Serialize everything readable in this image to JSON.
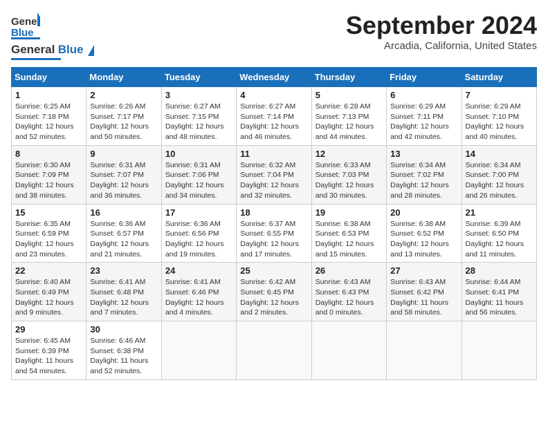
{
  "header": {
    "logo_general": "General",
    "logo_blue": "Blue",
    "month": "September 2024",
    "location": "Arcadia, California, United States"
  },
  "weekdays": [
    "Sunday",
    "Monday",
    "Tuesday",
    "Wednesday",
    "Thursday",
    "Friday",
    "Saturday"
  ],
  "weeks": [
    [
      {
        "day": "1",
        "sunrise": "Sunrise: 6:25 AM",
        "sunset": "Sunset: 7:18 PM",
        "daylight": "Daylight: 12 hours and 52 minutes."
      },
      {
        "day": "2",
        "sunrise": "Sunrise: 6:26 AM",
        "sunset": "Sunset: 7:17 PM",
        "daylight": "Daylight: 12 hours and 50 minutes."
      },
      {
        "day": "3",
        "sunrise": "Sunrise: 6:27 AM",
        "sunset": "Sunset: 7:15 PM",
        "daylight": "Daylight: 12 hours and 48 minutes."
      },
      {
        "day": "4",
        "sunrise": "Sunrise: 6:27 AM",
        "sunset": "Sunset: 7:14 PM",
        "daylight": "Daylight: 12 hours and 46 minutes."
      },
      {
        "day": "5",
        "sunrise": "Sunrise: 6:28 AM",
        "sunset": "Sunset: 7:13 PM",
        "daylight": "Daylight: 12 hours and 44 minutes."
      },
      {
        "day": "6",
        "sunrise": "Sunrise: 6:29 AM",
        "sunset": "Sunset: 7:11 PM",
        "daylight": "Daylight: 12 hours and 42 minutes."
      },
      {
        "day": "7",
        "sunrise": "Sunrise: 6:29 AM",
        "sunset": "Sunset: 7:10 PM",
        "daylight": "Daylight: 12 hours and 40 minutes."
      }
    ],
    [
      {
        "day": "8",
        "sunrise": "Sunrise: 6:30 AM",
        "sunset": "Sunset: 7:09 PM",
        "daylight": "Daylight: 12 hours and 38 minutes."
      },
      {
        "day": "9",
        "sunrise": "Sunrise: 6:31 AM",
        "sunset": "Sunset: 7:07 PM",
        "daylight": "Daylight: 12 hours and 36 minutes."
      },
      {
        "day": "10",
        "sunrise": "Sunrise: 6:31 AM",
        "sunset": "Sunset: 7:06 PM",
        "daylight": "Daylight: 12 hours and 34 minutes."
      },
      {
        "day": "11",
        "sunrise": "Sunrise: 6:32 AM",
        "sunset": "Sunset: 7:04 PM",
        "daylight": "Daylight: 12 hours and 32 minutes."
      },
      {
        "day": "12",
        "sunrise": "Sunrise: 6:33 AM",
        "sunset": "Sunset: 7:03 PM",
        "daylight": "Daylight: 12 hours and 30 minutes."
      },
      {
        "day": "13",
        "sunrise": "Sunrise: 6:34 AM",
        "sunset": "Sunset: 7:02 PM",
        "daylight": "Daylight: 12 hours and 28 minutes."
      },
      {
        "day": "14",
        "sunrise": "Sunrise: 6:34 AM",
        "sunset": "Sunset: 7:00 PM",
        "daylight": "Daylight: 12 hours and 26 minutes."
      }
    ],
    [
      {
        "day": "15",
        "sunrise": "Sunrise: 6:35 AM",
        "sunset": "Sunset: 6:59 PM",
        "daylight": "Daylight: 12 hours and 23 minutes."
      },
      {
        "day": "16",
        "sunrise": "Sunrise: 6:36 AM",
        "sunset": "Sunset: 6:57 PM",
        "daylight": "Daylight: 12 hours and 21 minutes."
      },
      {
        "day": "17",
        "sunrise": "Sunrise: 6:36 AM",
        "sunset": "Sunset: 6:56 PM",
        "daylight": "Daylight: 12 hours and 19 minutes."
      },
      {
        "day": "18",
        "sunrise": "Sunrise: 6:37 AM",
        "sunset": "Sunset: 6:55 PM",
        "daylight": "Daylight: 12 hours and 17 minutes."
      },
      {
        "day": "19",
        "sunrise": "Sunrise: 6:38 AM",
        "sunset": "Sunset: 6:53 PM",
        "daylight": "Daylight: 12 hours and 15 minutes."
      },
      {
        "day": "20",
        "sunrise": "Sunrise: 6:38 AM",
        "sunset": "Sunset: 6:52 PM",
        "daylight": "Daylight: 12 hours and 13 minutes."
      },
      {
        "day": "21",
        "sunrise": "Sunrise: 6:39 AM",
        "sunset": "Sunset: 6:50 PM",
        "daylight": "Daylight: 12 hours and 11 minutes."
      }
    ],
    [
      {
        "day": "22",
        "sunrise": "Sunrise: 6:40 AM",
        "sunset": "Sunset: 6:49 PM",
        "daylight": "Daylight: 12 hours and 9 minutes."
      },
      {
        "day": "23",
        "sunrise": "Sunrise: 6:41 AM",
        "sunset": "Sunset: 6:48 PM",
        "daylight": "Daylight: 12 hours and 7 minutes."
      },
      {
        "day": "24",
        "sunrise": "Sunrise: 6:41 AM",
        "sunset": "Sunset: 6:46 PM",
        "daylight": "Daylight: 12 hours and 4 minutes."
      },
      {
        "day": "25",
        "sunrise": "Sunrise: 6:42 AM",
        "sunset": "Sunset: 6:45 PM",
        "daylight": "Daylight: 12 hours and 2 minutes."
      },
      {
        "day": "26",
        "sunrise": "Sunrise: 6:43 AM",
        "sunset": "Sunset: 6:43 PM",
        "daylight": "Daylight: 12 hours and 0 minutes."
      },
      {
        "day": "27",
        "sunrise": "Sunrise: 6:43 AM",
        "sunset": "Sunset: 6:42 PM",
        "daylight": "Daylight: 11 hours and 58 minutes."
      },
      {
        "day": "28",
        "sunrise": "Sunrise: 6:44 AM",
        "sunset": "Sunset: 6:41 PM",
        "daylight": "Daylight: 11 hours and 56 minutes."
      }
    ],
    [
      {
        "day": "29",
        "sunrise": "Sunrise: 6:45 AM",
        "sunset": "Sunset: 6:39 PM",
        "daylight": "Daylight: 11 hours and 54 minutes."
      },
      {
        "day": "30",
        "sunrise": "Sunrise: 6:46 AM",
        "sunset": "Sunset: 6:38 PM",
        "daylight": "Daylight: 11 hours and 52 minutes."
      },
      null,
      null,
      null,
      null,
      null
    ]
  ]
}
